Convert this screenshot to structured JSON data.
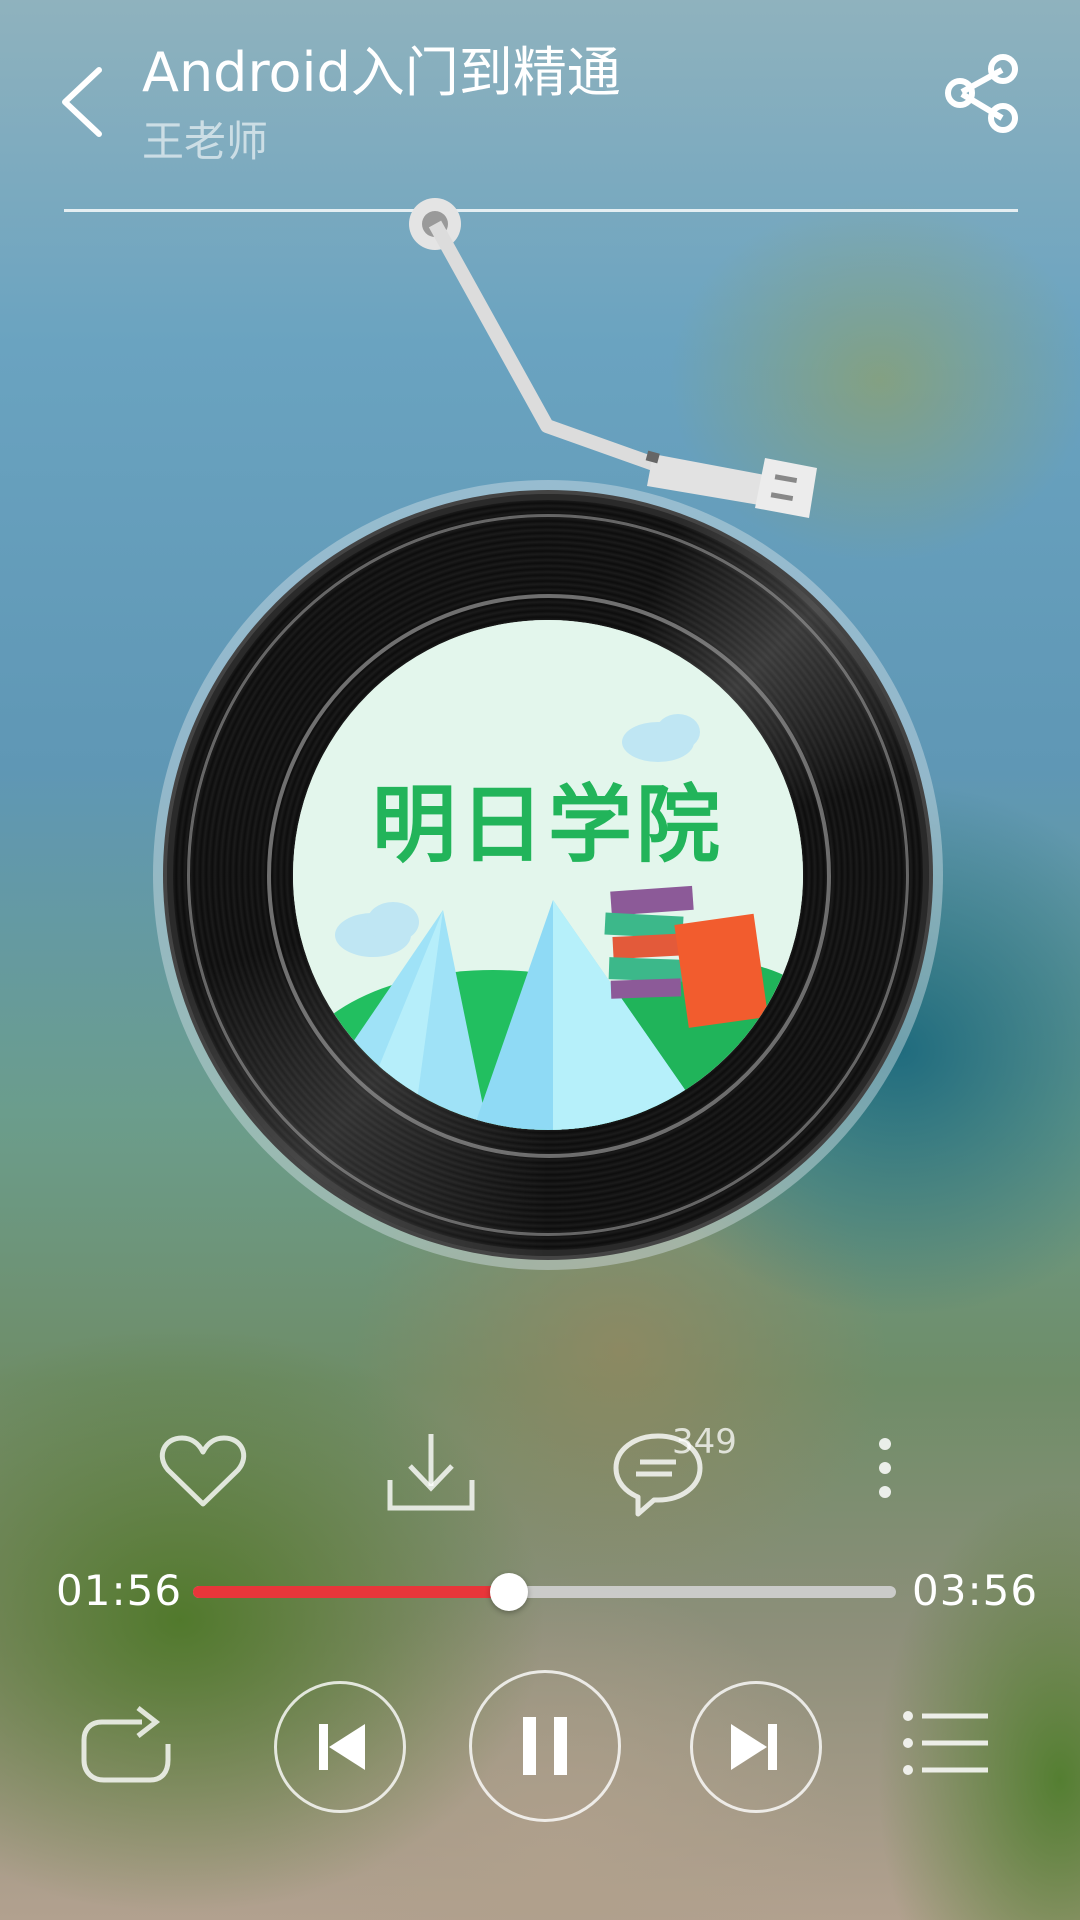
{
  "header": {
    "title": "Android入门到精通",
    "subtitle": "王老师"
  },
  "disc": {
    "label_text": "明日学院"
  },
  "actions": {
    "comment_count": "349"
  },
  "progress": {
    "current_time": "01:56",
    "total_time": "03:56",
    "fraction": 0.45,
    "fill_color": "#e8363a"
  },
  "icons": [
    "back-icon",
    "share-icon",
    "heart-icon",
    "download-icon",
    "comment-icon",
    "more-vertical-icon",
    "repeat-icon",
    "skip-previous-icon",
    "pause-icon",
    "skip-next-icon",
    "playlist-icon"
  ]
}
